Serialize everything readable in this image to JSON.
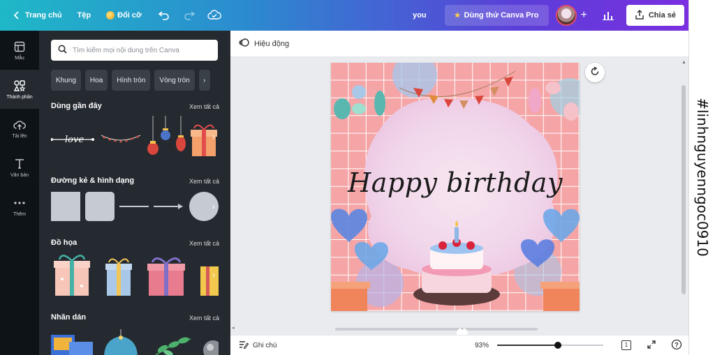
{
  "topbar": {
    "home": "Trang chủ",
    "file": "Tệp",
    "resize": "Đổi cỡ",
    "user": "you",
    "pro": "Dùng thử Canva Pro",
    "share": "Chia sẻ"
  },
  "rail": {
    "items": [
      {
        "label": "Mẫu",
        "icon": "template-icon"
      },
      {
        "label": "Thành phần",
        "icon": "elements-icon"
      },
      {
        "label": "Tải lên",
        "icon": "upload-icon"
      },
      {
        "label": "Văn bản",
        "icon": "text-icon"
      },
      {
        "label": "Thêm",
        "icon": "more-icon"
      }
    ]
  },
  "panel": {
    "search_placeholder": "Tìm kiếm mọi nội dung trên Canva",
    "chips": [
      "Khung",
      "Hoa",
      "Hình tròn",
      "Vòng tròn"
    ],
    "see_all": "Xem tất cả",
    "sections": [
      {
        "title": "Dùng gần đây"
      },
      {
        "title": "Đường kẻ & hình dạng"
      },
      {
        "title": "Đồ họa"
      },
      {
        "title": "Nhãn dán"
      }
    ],
    "love_script": "love"
  },
  "editor": {
    "animate": "Hiệu động",
    "canvas_text": "Happy birthday",
    "notes": "Ghi chú",
    "zoom": "93%",
    "page_count": "1"
  },
  "watermark": "#linhnguyenngoc0910",
  "colors": {
    "accent_start": "#1fb8c8",
    "accent_end": "#7a2fe0",
    "panel_bg": "#252a30",
    "rail_bg": "#0e1318",
    "canvas_pink": "#f5a9aa"
  }
}
